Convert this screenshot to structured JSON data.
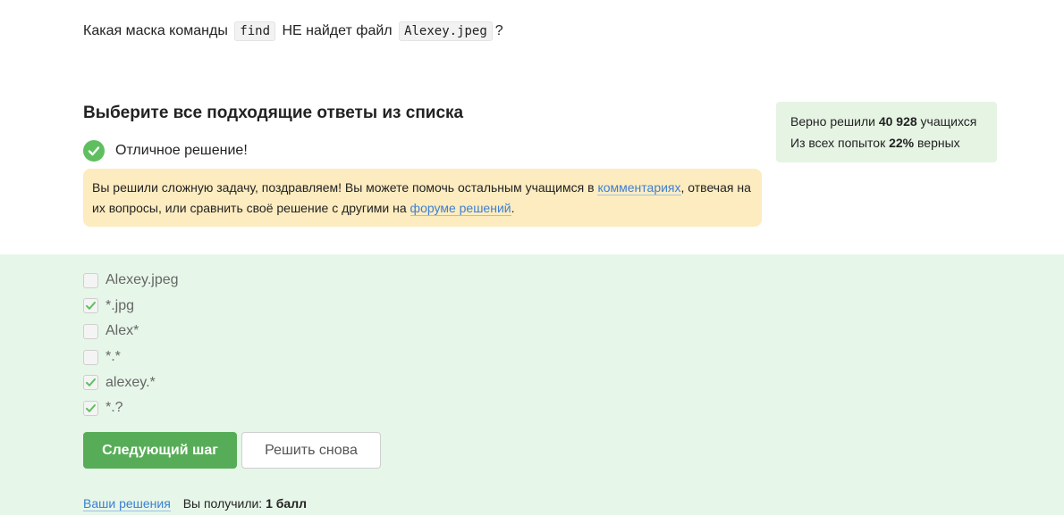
{
  "question": {
    "part1": "Какая маска команды",
    "code1": "find",
    "part2": "НЕ найдет файл",
    "code2": "Alexey.jpeg",
    "part3": "?"
  },
  "heading": "Выберите все подходящие ответы из списка",
  "result": {
    "text": "Отличное решение!",
    "icon": "check-circle-icon",
    "color": "#5fbf5f"
  },
  "notice": {
    "text1": "Вы решили сложную задачу, поздравляем! Вы можете помочь остальным учащимся в",
    "link1": "комментариях",
    "text2": ", отвечая на их вопросы, или сравнить своё решение с другими на",
    "link2": "форуме решений",
    "text3": "."
  },
  "stats": {
    "line1_prefix": "Верно решили",
    "line1_value": "40 928",
    "line1_suffix": "учащихся",
    "line2_prefix": "Из всех попыток",
    "line2_value": "22%",
    "line2_suffix": "верных"
  },
  "options": [
    {
      "label": "Alexey.jpeg",
      "checked": false
    },
    {
      "label": "*.jpg",
      "checked": true
    },
    {
      "label": "Alex*",
      "checked": false
    },
    {
      "label": "*.*",
      "checked": false
    },
    {
      "label": "alexey.*",
      "checked": true
    },
    {
      "label": "*.?",
      "checked": true
    }
  ],
  "buttons": {
    "next": "Следующий шаг",
    "again": "Решить снова"
  },
  "footer": {
    "link": "Ваши решения",
    "score_label": "Вы получили:",
    "score_value": "1 балл"
  },
  "colors": {
    "accent_green": "#57ad57",
    "link": "#3d7fd1",
    "notice_bg": "#fdecc0",
    "answer_area_bg": "#e6f6e8"
  }
}
